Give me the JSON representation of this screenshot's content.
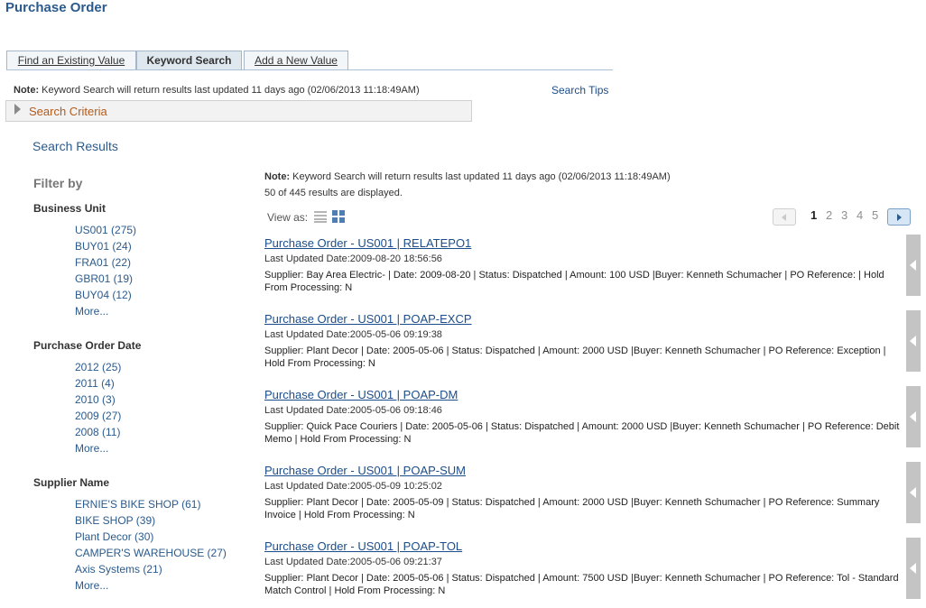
{
  "page": {
    "title": "Purchase Order"
  },
  "tabs": [
    {
      "label": "Find an Existing Value"
    },
    {
      "label": "Keyword Search"
    },
    {
      "label": "Add a New Value"
    }
  ],
  "note": {
    "prefix": "Note:",
    "text": " Keyword Search will return results last updated 11 days ago (02/06/2013 11:18:49AM)"
  },
  "search_tips": "Search Tips",
  "search_criteria": "Search Criteria",
  "search_results_title": "Search Results",
  "filter": {
    "title": "Filter by",
    "facets": [
      {
        "title": "Business Unit",
        "items": [
          "US001 (275)",
          "BUY01 (24)",
          "FRA01 (22)",
          "GBR01 (19)",
          "BUY04 (12)",
          "More..."
        ]
      },
      {
        "title": "Purchase Order Date",
        "items": [
          "2012 (25)",
          "2011 (4)",
          "2010 (3)",
          "2009 (27)",
          "2008 (11)",
          "More..."
        ]
      },
      {
        "title": "Supplier Name",
        "items": [
          "ERNIE'S BIKE SHOP (61)",
          "BIKE SHOP (39)",
          "Plant Decor (30)",
          "CAMPER'S WAREHOUSE (27)",
          "Axis Systems (21)",
          "More..."
        ]
      }
    ]
  },
  "results": {
    "note_prefix": "Note:",
    "note_text": " Keyword Search will return results last updated 11 days ago (02/06/2013 11:18:49AM)",
    "count_text": "50 of 445 results are displayed.",
    "view_as": "View as:",
    "pages": [
      "1",
      "2",
      "3",
      "4",
      "5"
    ],
    "current_page": "1",
    "items": [
      {
        "title": "Purchase Order - US001 | RELATEPO1",
        "updated": "Last Updated Date:2009-08-20 18:56:56",
        "desc": "Supplier: Bay Area Electric- | Date: 2009-08-20 | Status: Dispatched | Amount: 100 USD |Buyer: Kenneth Schumacher | PO Reference: | Hold From Processing: N"
      },
      {
        "title": "Purchase Order - US001 | POAP-EXCP",
        "updated": "Last Updated Date:2005-05-06 09:19:38",
        "desc": "Supplier: Plant Decor | Date: 2005-05-06 | Status: Dispatched | Amount: 2000 USD |Buyer: Kenneth Schumacher | PO Reference: Exception | Hold From Processing: N"
      },
      {
        "title": "Purchase Order - US001 | POAP-DM",
        "updated": "Last Updated Date:2005-05-06 09:18:46",
        "desc": "Supplier: Quick Pace Couriers | Date: 2005-05-06 | Status: Dispatched | Amount: 2000 USD |Buyer: Kenneth Schumacher | PO Reference: Debit Memo | Hold From Processing: N"
      },
      {
        "title": "Purchase Order - US001 | POAP-SUM",
        "updated": "Last Updated Date:2005-05-09 10:25:02",
        "desc": "Supplier: Plant Decor | Date: 2005-05-09 | Status: Dispatched | Amount: 2000 USD |Buyer: Kenneth Schumacher | PO Reference: Summary Invoice | Hold From Processing: N"
      },
      {
        "title": "Purchase Order - US001 | POAP-TOL",
        "updated": "Last Updated Date:2005-05-06 09:21:37",
        "desc": "Supplier: Plant Decor | Date: 2005-05-06 | Status: Dispatched | Amount: 7500 USD |Buyer: Kenneth Schumacher | PO Reference: Tol - Standard Match Control | Hold From Processing: N"
      }
    ]
  },
  "colors": {
    "title_blue": "#2b5a8c",
    "link_blue": "#1b4d8c",
    "criteria_orange": "#b35b1c",
    "side_tab_gray": "#c4c4c4"
  }
}
